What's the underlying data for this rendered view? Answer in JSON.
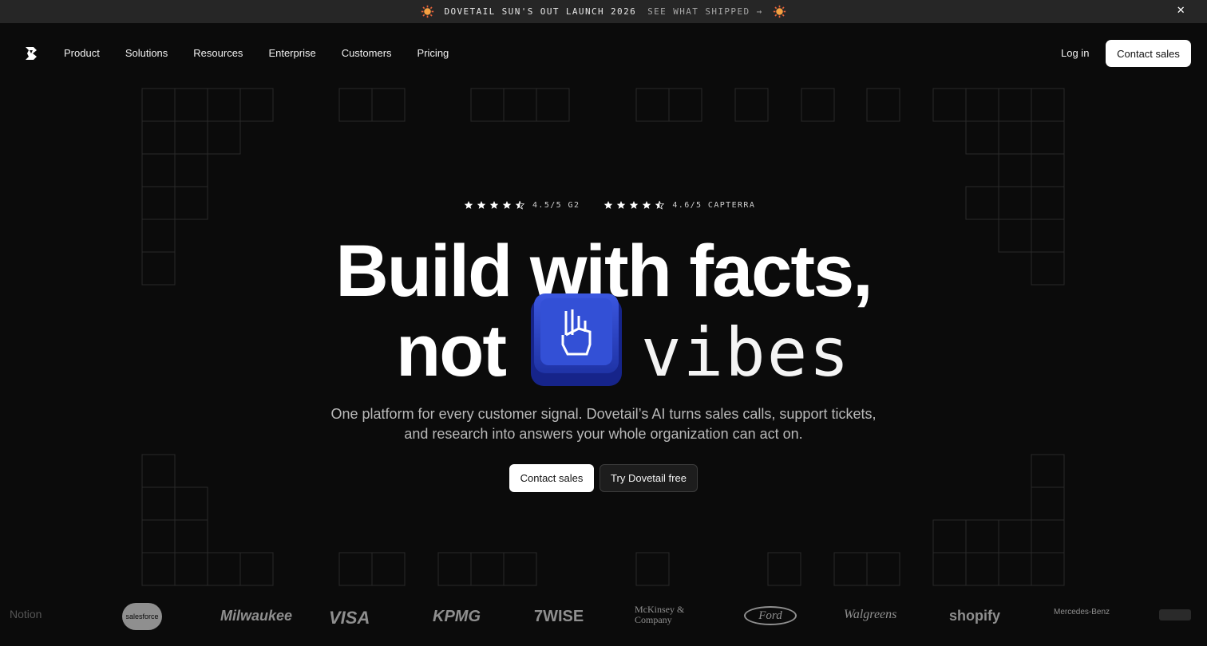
{
  "announcement": {
    "launch_text": "DOVETAIL SUN'S OUT LAUNCH 2026",
    "cta_text": "SEE WHAT SHIPPED →",
    "close_glyph": "✕"
  },
  "nav": {
    "items": [
      {
        "label": "Product"
      },
      {
        "label": "Solutions"
      },
      {
        "label": "Resources"
      },
      {
        "label": "Enterprise"
      },
      {
        "label": "Customers"
      },
      {
        "label": "Pricing"
      }
    ],
    "login": "Log in",
    "contact": "Contact sales"
  },
  "ratings": [
    {
      "stars": 4.5,
      "text": "4.5/5 G2"
    },
    {
      "stars": 4.5,
      "text": "4.6/5 CAPTERRA"
    }
  ],
  "hero": {
    "line1": "Build with facts,",
    "line2_word": "not",
    "line2_mono": "vibes",
    "subtext": "One platform for every customer signal. Dovetail’s AI turns sales calls, support tickets, and research into answers your whole organization can act on.",
    "cta_primary": "Contact sales",
    "cta_secondary": "Try Dovetail free"
  },
  "logos": [
    {
      "name": "Notion"
    },
    {
      "name": "salesforce"
    },
    {
      "name": "Milwaukee"
    },
    {
      "name": "VISA"
    },
    {
      "name": "KPMG"
    },
    {
      "name": "7WISE"
    },
    {
      "name": "McKinsey & Company"
    },
    {
      "name": "Ford"
    },
    {
      "name": "Walgreens"
    },
    {
      "name": "shopify"
    },
    {
      "name": "Mercedes-Benz"
    }
  ],
  "colors": {
    "background": "#0b0b0b",
    "announce_bar": "#262626",
    "key_blue": "#2d46c8",
    "logo_gray": "#8f8f8f"
  }
}
